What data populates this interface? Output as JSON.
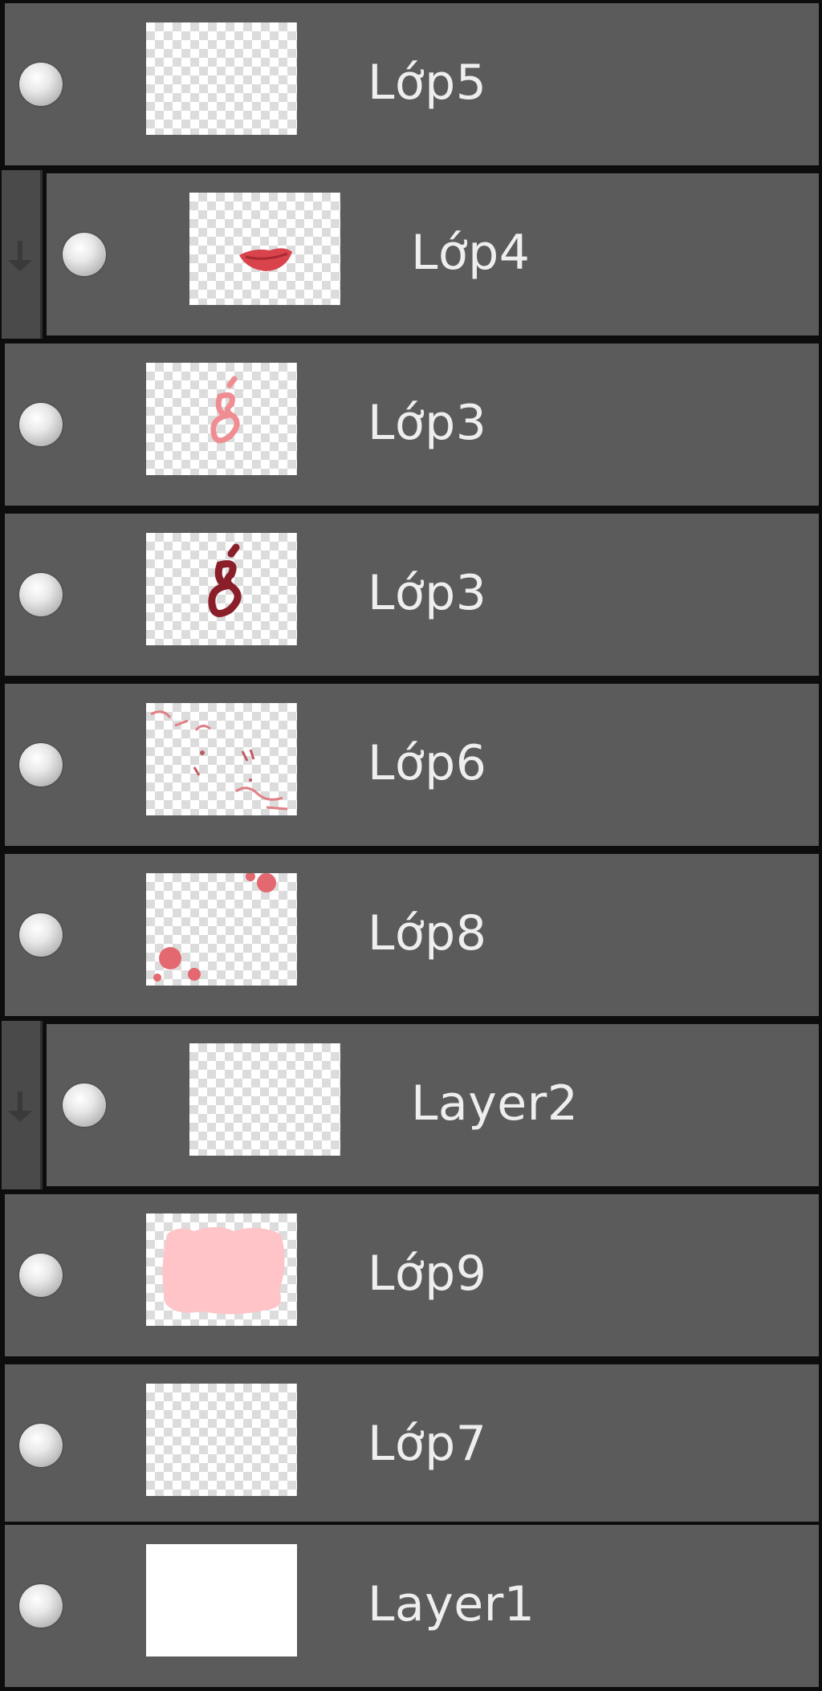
{
  "layers": [
    {
      "name": "Lớp5",
      "clipped": false,
      "thumb": "empty",
      "visibility_icon": "eye-dot-icon"
    },
    {
      "name": "Lớp4",
      "clipped": true,
      "thumb": "lips",
      "visibility_icon": "eye-dot-icon"
    },
    {
      "name": "Lớp3",
      "clipped": false,
      "thumb": "glyph-light",
      "visibility_icon": "eye-dot-icon"
    },
    {
      "name": "Lớp3",
      "clipped": false,
      "thumb": "glyph-dark",
      "visibility_icon": "eye-dot-icon"
    },
    {
      "name": "Lớp6",
      "clipped": false,
      "thumb": "sketch",
      "visibility_icon": "eye-dot-icon"
    },
    {
      "name": "Lớp8",
      "clipped": false,
      "thumb": "dots",
      "visibility_icon": "eye-dot-icon"
    },
    {
      "name": "Layer2",
      "clipped": true,
      "thumb": "empty",
      "visibility_icon": "eye-dot-icon"
    },
    {
      "name": "Lớp9",
      "clipped": false,
      "thumb": "pink-fill",
      "visibility_icon": "eye-dot-icon"
    },
    {
      "name": "Lớp7",
      "clipped": false,
      "thumb": "empty",
      "visibility_icon": "eye-dot-icon"
    },
    {
      "name": "Layer1",
      "clipped": false,
      "thumb": "white",
      "visibility_icon": "eye-dot-icon"
    }
  ],
  "colors": {
    "row_bg": "#5b5b5b",
    "divider": "#0d0d0d",
    "text": "#eeeeee",
    "accent_red": "#d9434b",
    "accent_dark_red": "#8a1f2a",
    "pink": "#ffc4c7"
  }
}
